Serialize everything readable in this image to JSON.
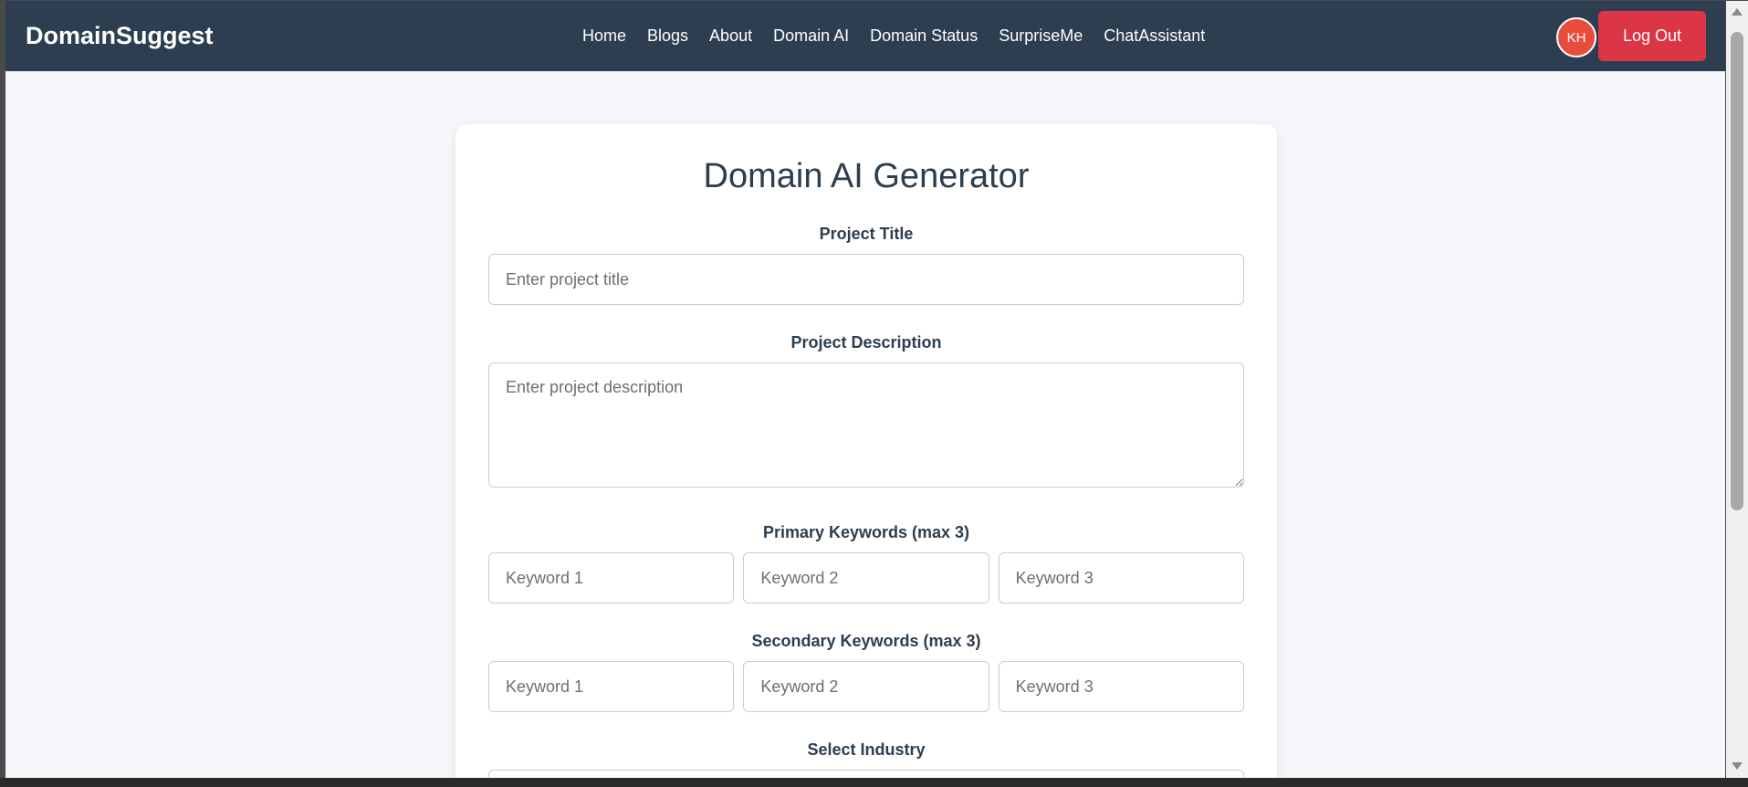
{
  "navbar": {
    "brand": "DomainSuggest",
    "links": [
      "Home",
      "Blogs",
      "About",
      "Domain AI",
      "Domain Status",
      "SurpriseMe",
      "ChatAssistant"
    ],
    "avatar_initials": "KH",
    "logout_label": "Log Out"
  },
  "form": {
    "title": "Domain AI Generator",
    "project_title_label": "Project Title",
    "project_title_placeholder": "Enter project title",
    "project_description_label": "Project Description",
    "project_description_placeholder": "Enter project description",
    "primary_keywords_label": "Primary Keywords (max 3)",
    "primary_keyword_placeholders": [
      "Keyword 1",
      "Keyword 2",
      "Keyword 3"
    ],
    "secondary_keywords_label": "Secondary Keywords (max 3)",
    "secondary_keyword_placeholders": [
      "Keyword 1",
      "Keyword 2",
      "Keyword 3"
    ],
    "industry_label": "Select Industry"
  },
  "colors": {
    "navbar_bg": "#2c3e50",
    "logout_bg": "#dc3545",
    "avatar_bg": "#e74c3c",
    "page_bg": "#f5f6f9",
    "title_color": "#2c3e50"
  }
}
